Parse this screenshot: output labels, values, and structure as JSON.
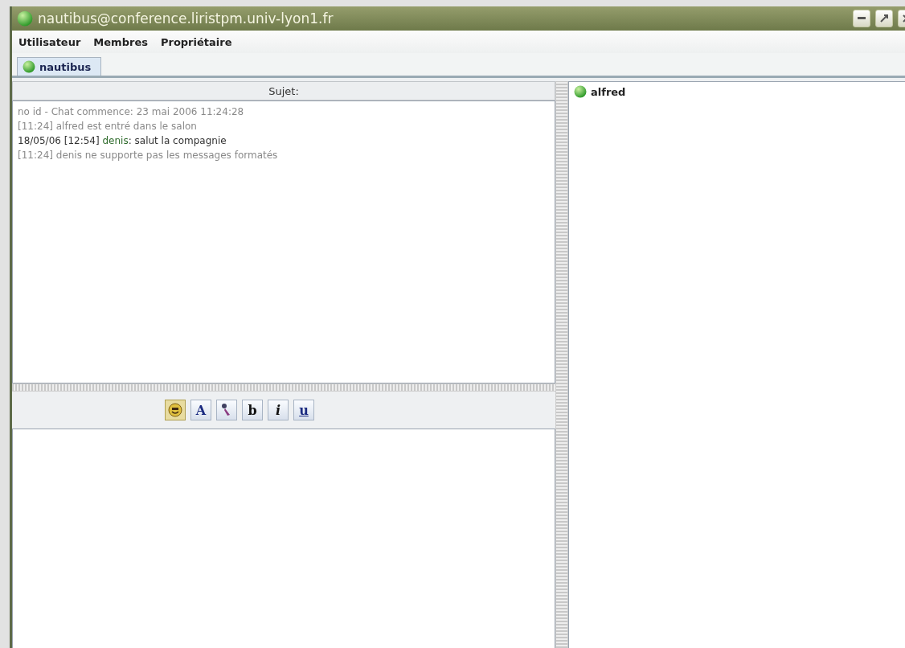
{
  "window": {
    "title": "nautibus@conference.liristpm.univ-lyon1.fr"
  },
  "menu": [
    {
      "label": "Utilisateur"
    },
    {
      "label": "Membres"
    },
    {
      "label": "Propriétaire"
    }
  ],
  "tabs": [
    {
      "label": "nautibus",
      "selected": true
    }
  ],
  "subject": {
    "label": "Sujet:"
  },
  "messages": [
    {
      "kind": "status",
      "text": "no id - Chat commence: 23 mai 2006 11:24:28"
    },
    {
      "kind": "status",
      "text": "[11:24] alfred est entré dans le salon"
    },
    {
      "kind": "message",
      "stamp": "18/05/06 [12:54]",
      "author": "denis",
      "text": ": salut la compagnie"
    },
    {
      "kind": "status",
      "text": "[11:24] denis ne supporte pas les messages formatés"
    }
  ],
  "toolbar": [
    {
      "kind": "emoticon",
      "selected": true
    },
    {
      "kind": "font",
      "label": "A",
      "selected": false
    },
    {
      "kind": "color",
      "selected": false
    },
    {
      "kind": "bold",
      "label": "b",
      "selected": false
    },
    {
      "kind": "italic",
      "label": "i",
      "selected": false
    },
    {
      "kind": "underline",
      "label": "u",
      "selected": false
    }
  ],
  "roster": [
    {
      "name": "alfred"
    }
  ]
}
